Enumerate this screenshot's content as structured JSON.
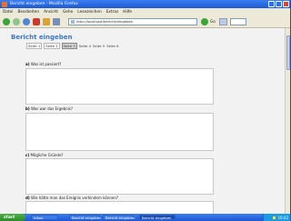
{
  "window": {
    "title": "Bericht eingeben - Mozilla Firefox"
  },
  "menubar": {
    "items": [
      "Datei",
      "Bearbeiten",
      "Ansicht",
      "Gehe",
      "Lesezeichen",
      "Extras",
      "Hilfe"
    ]
  },
  "toolbar": {
    "url": "http://localhost/bericht/eingeben",
    "go_label": "Go",
    "icons": [
      "back-icon",
      "forward-icon",
      "reload-icon",
      "stop-icon",
      "home-icon"
    ]
  },
  "page": {
    "title": "Bericht eingeben",
    "steps": [
      "Seite 1",
      "Seite 2",
      "Seite 3",
      "Seite 4",
      "Seite 5",
      "Seite 6"
    ],
    "active_step": "Seite 2",
    "questions": [
      {
        "letter": "a)",
        "text": "Was ist passiert?"
      },
      {
        "letter": "b)",
        "text": "Was war das Ergebnis?"
      },
      {
        "letter": "c)",
        "text": "Mögliche Gründe?"
      },
      {
        "letter": "d)",
        "text": "Wie hätte man das Ereignis verhindern können?"
      }
    ]
  },
  "taskbar": {
    "start_label": "start",
    "tasks": [
      "Inbox",
      "Bericht eingeben",
      "Bericht eingeben",
      "Bericht eingeben"
    ],
    "clock": "10:42"
  }
}
